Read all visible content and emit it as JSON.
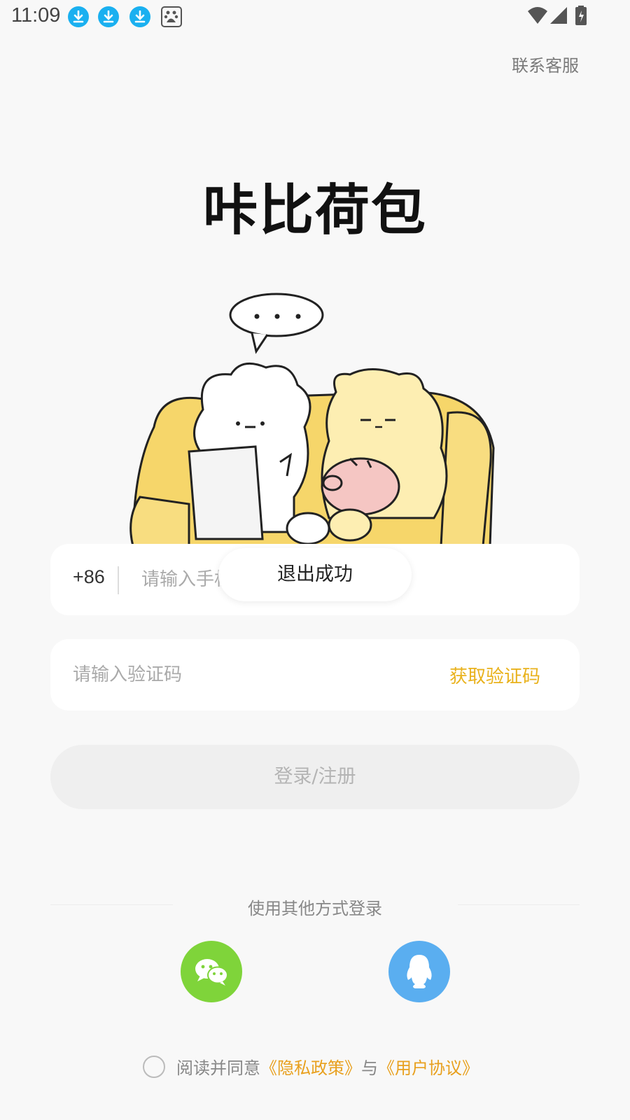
{
  "status_bar": {
    "time": "11:09",
    "notification_icons": [
      "download-icon",
      "download-icon",
      "download-icon",
      "baidu-icon"
    ],
    "system_icons": [
      "wifi-icon",
      "signal-icon",
      "battery-charging-icon"
    ]
  },
  "header": {
    "contact_label": "联系客服"
  },
  "brand": {
    "title": "咔比荷包"
  },
  "phone_field": {
    "country_code": "+86",
    "placeholder": "请输入手机号"
  },
  "code_field": {
    "placeholder": "请输入验证码",
    "get_code_label": "获取验证码"
  },
  "toast": {
    "message": "退出成功"
  },
  "login": {
    "button_label": "登录/注册"
  },
  "other_login": {
    "label": "使用其他方式登录",
    "options": [
      "wechat-icon",
      "qq-icon"
    ]
  },
  "agreement": {
    "prefix": "阅读并同意",
    "privacy_label": "《隐私政策》",
    "joiner": "与",
    "terms_label": "《用户协议》"
  },
  "colors": {
    "accent": "#e9b21d",
    "link": "#e8a01e",
    "wechat": "#7fd43a",
    "qq": "#5aaef0",
    "background": "#f8f8f8"
  }
}
